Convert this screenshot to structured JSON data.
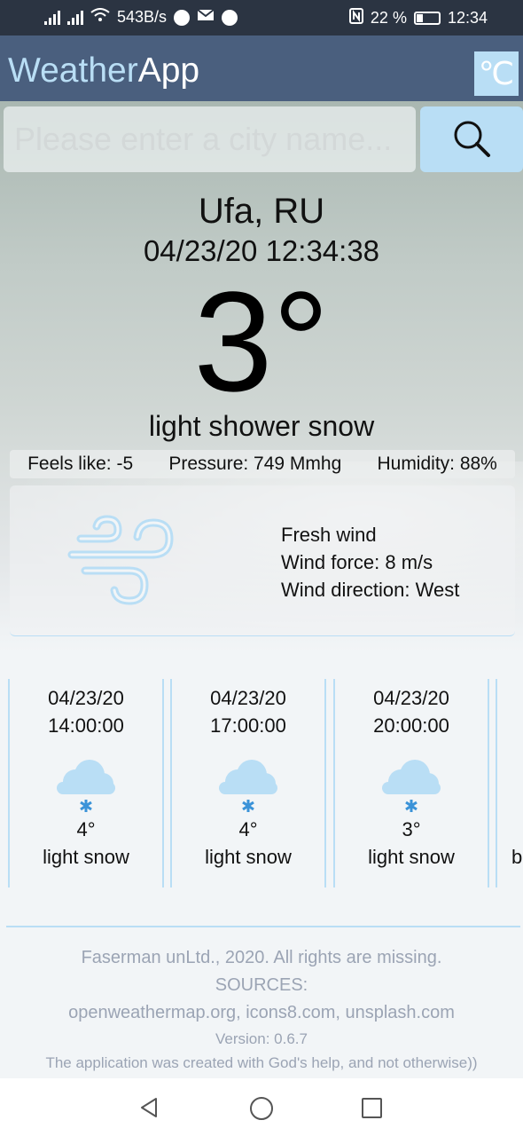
{
  "status_bar": {
    "speed": "543B/s",
    "battery": "22 %",
    "time": "12:34"
  },
  "app": {
    "title_part1": "Weather",
    "title_part2": "App",
    "unit_toggle": "℃"
  },
  "search": {
    "placeholder": "Please enter a city name..."
  },
  "current": {
    "city": "Ufa, RU",
    "datetime": "04/23/20 12:34:38",
    "temperature": "3°",
    "description": "light shower snow",
    "feels_like": "Feels like: -5",
    "pressure": "Pressure: 749 Mmhg",
    "humidity": "Humidity: 88%"
  },
  "wind": {
    "type": "Fresh wind",
    "force": "Wind force: 8 m/s",
    "direction": "Wind direction: West"
  },
  "forecast": [
    {
      "date": "04/23/20",
      "time": "14:00:00",
      "temp": "4°",
      "desc": "light snow",
      "icon": "snow-cloud-icon"
    },
    {
      "date": "04/23/20",
      "time": "17:00:00",
      "temp": "4°",
      "desc": "light snow",
      "icon": "snow-cloud-icon"
    },
    {
      "date": "04/23/20",
      "time": "20:00:00",
      "temp": "3°",
      "desc": "light snow",
      "icon": "snow-cloud-icon"
    },
    {
      "date": "",
      "time": "",
      "temp": "",
      "desc": "b",
      "icon": ""
    }
  ],
  "footer": {
    "copyright": "Faserman unLtd., 2020. All rights are missing.",
    "sources_label": "SOURCES:",
    "sources": "openweathermap.org, icons8.com, unsplash.com",
    "version": "Version: 0.6.7",
    "note": "The application was created with God's help, and not otherwise))"
  },
  "colors": {
    "accent": "#b9def5",
    "app_bar": "#4a5f7e",
    "status_bar": "#2b3442"
  }
}
